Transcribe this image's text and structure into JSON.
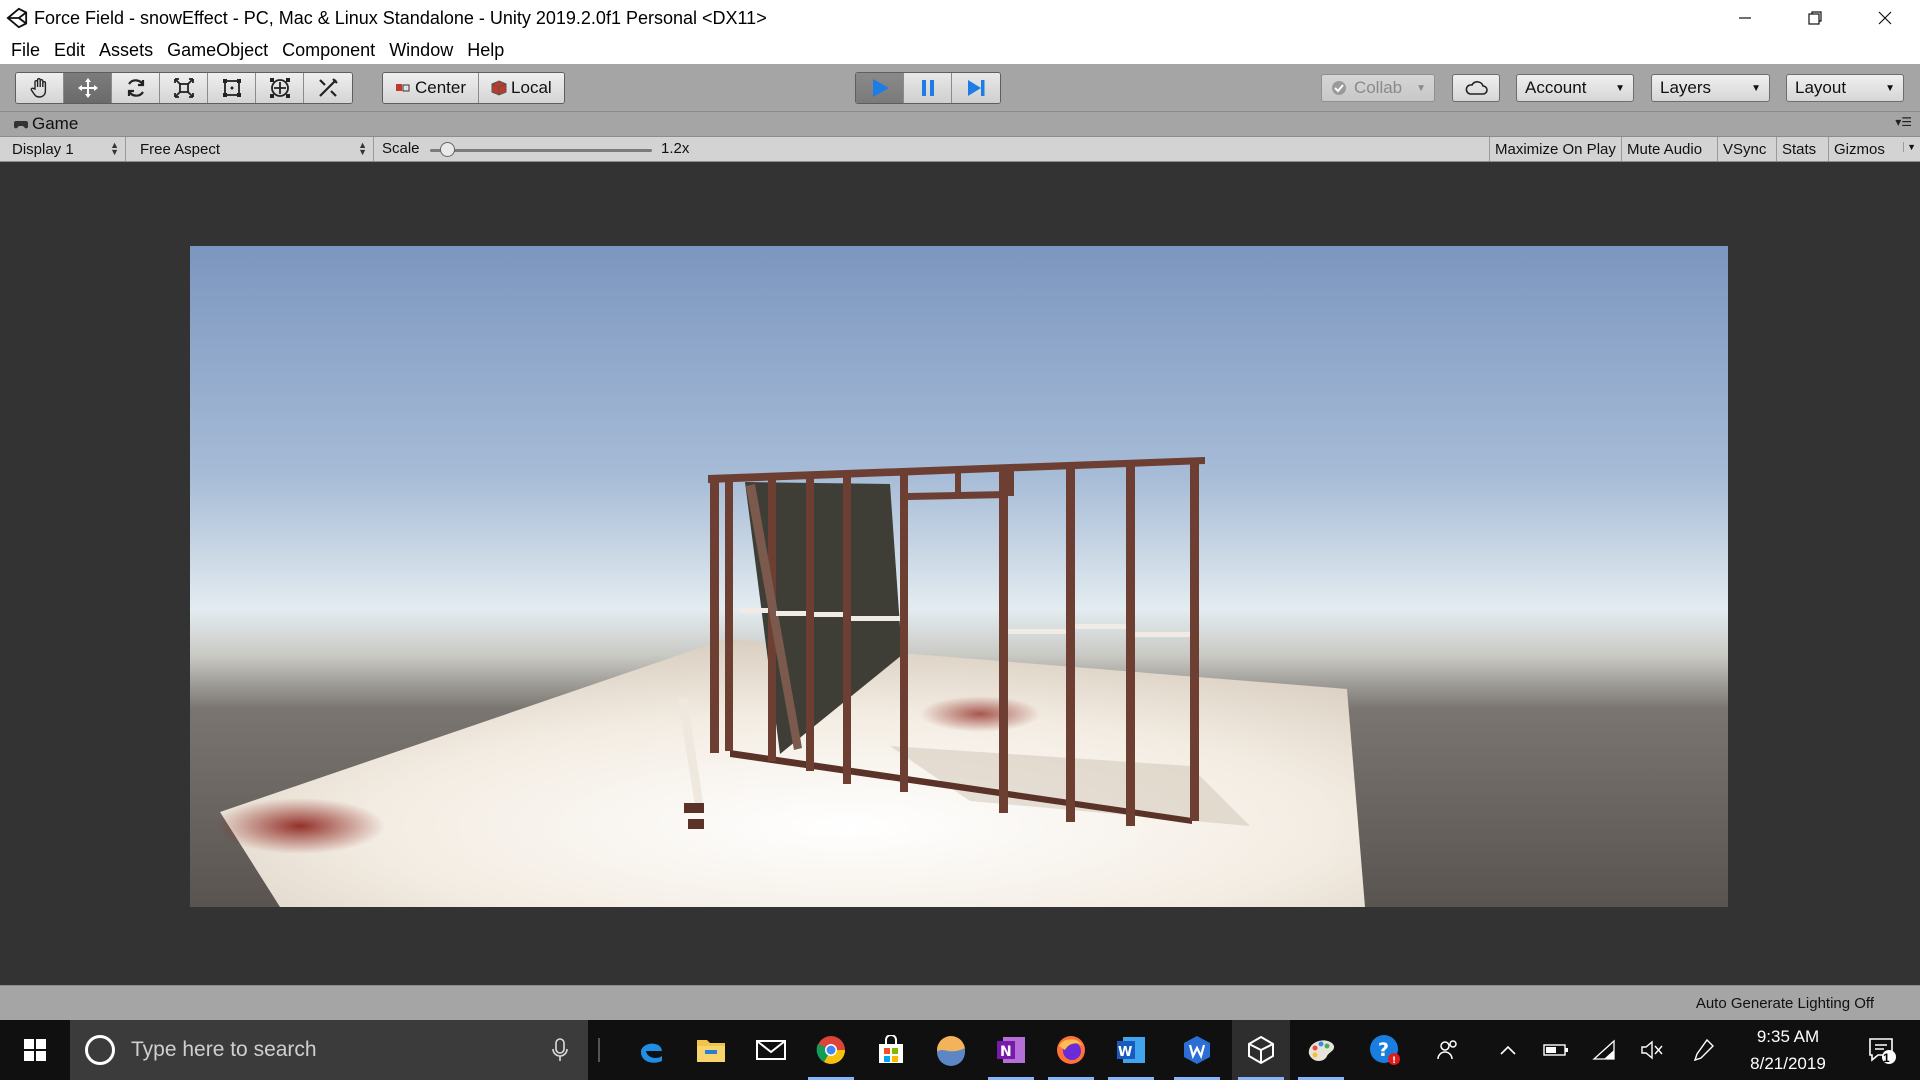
{
  "window": {
    "title": "Force Field - snowEffect - PC, Mac & Linux Standalone - Unity 2019.2.0f1 Personal <DX11>"
  },
  "menu": [
    "File",
    "Edit",
    "Assets",
    "GameObject",
    "Component",
    "Window",
    "Help"
  ],
  "toolbar": {
    "tools": [
      "hand-tool",
      "move-tool",
      "rotate-tool",
      "scale-tool",
      "rect-tool",
      "transform-tool",
      "custom-tool"
    ],
    "active_tool": "move-tool",
    "pivot_mode": "Center",
    "pivot_rotation": "Local",
    "play_active": true,
    "collab": "Collab",
    "account": "Account",
    "layers": "Layers",
    "layout": "Layout"
  },
  "game_tab": {
    "label": "Game"
  },
  "game_bar": {
    "display": "Display 1",
    "aspect": "Free Aspect",
    "scale_label": "Scale",
    "scale_value": "1.2x",
    "scale_fraction": 0.08,
    "maximize_on_play": "Maximize On Play",
    "mute_audio": "Mute Audio",
    "vsync": "VSync",
    "stats": "Stats",
    "gizmos": "Gizmos"
  },
  "status": {
    "text": "Auto Generate Lighting Off"
  },
  "taskbar": {
    "search_placeholder": "Type here to search",
    "pinned": [
      "edge-icon",
      "file-explorer-icon",
      "mail-icon",
      "chrome-icon",
      "store-icon",
      "photos-icon",
      "onenote-icon",
      "firefox-icon",
      "word-icon",
      "wps-icon",
      "unity-icon",
      "paint-icon",
      "help-icon"
    ],
    "time": "9:35 AM",
    "date": "8/21/2019",
    "notification_count": "1"
  },
  "colors": {
    "editor_bg": "#a5a5a5",
    "game_bg": "#333333",
    "play_blue": "#1e7ce6",
    "taskbar": "#101010"
  }
}
